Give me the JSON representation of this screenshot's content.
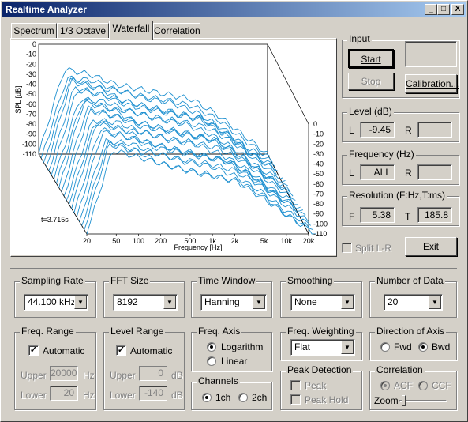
{
  "window": {
    "title": "Realtime Analyzer"
  },
  "title_buttons": {
    "minimize": "_",
    "maximize": "□",
    "close": "X"
  },
  "tabs": [
    "Spectrum",
    "1/3 Octave",
    "Waterfall",
    "Correlation"
  ],
  "selected_tab": "Waterfall",
  "plot": {
    "ylabel": "SPL [dB]",
    "xlabel": "Frequency [Hz]",
    "y_ticks": [
      "0",
      "-10",
      "-20",
      "-30",
      "-40",
      "-50",
      "-60",
      "-70",
      "-80",
      "-90",
      "-100",
      "-110"
    ],
    "z_ticks": [
      "0",
      "-10",
      "-20",
      "-30",
      "-40",
      "-50",
      "-60",
      "-70",
      "-80",
      "-90",
      "-100",
      "-110"
    ],
    "x_ticks": [
      "20",
      "50",
      "100",
      "200",
      "500",
      "1k",
      "2k",
      "5k",
      "10k",
      "20k"
    ],
    "time_label": "t=3.715s",
    "line_color": "#1e90d0"
  },
  "chart_data": {
    "type": "line",
    "title": "",
    "xlabel": "Frequency [Hz]",
    "ylabel": "SPL [dB]",
    "x": [
      20,
      50,
      100,
      200,
      500,
      1000,
      2000,
      5000,
      10000,
      20000
    ],
    "xscale": "log",
    "ylim": [
      -110,
      0
    ],
    "xlim": [
      20,
      20000
    ],
    "series": [
      {
        "values": [
          -110,
          -25,
          -30,
          -40,
          -45,
          -50,
          -55,
          -70,
          -90,
          -110
        ]
      },
      {
        "values": [
          -110,
          -30,
          -32,
          -42,
          -48,
          -52,
          -58,
          -72,
          -92,
          -110
        ]
      },
      {
        "values": [
          -110,
          -28,
          -35,
          -38,
          -46,
          -50,
          -60,
          -75,
          -95,
          -110
        ]
      },
      {
        "values": [
          -110,
          -22,
          -30,
          -44,
          -50,
          -55,
          -62,
          -78,
          -96,
          -110
        ]
      },
      {
        "values": [
          -110,
          -26,
          -33,
          -40,
          -47,
          -53,
          -57,
          -73,
          -94,
          -110
        ]
      }
    ]
  },
  "input": {
    "label": "Input",
    "start": "Start",
    "stop": "Stop",
    "calibration": "Calibration..."
  },
  "level": {
    "label": "Level (dB)",
    "l_label": "L",
    "l_value": "-9.45",
    "r_label": "R",
    "r_value": ""
  },
  "frequency": {
    "label": "Frequency (Hz)",
    "l_label": "L",
    "l_value": "ALL",
    "r_label": "R",
    "r_value": ""
  },
  "resolution": {
    "label": "Resolution (F:Hz,T:ms)",
    "f_label": "F",
    "f_value": "5.38",
    "t_label": "T",
    "t_value": "185.8"
  },
  "split": {
    "label": "Split L-R"
  },
  "exit": {
    "label": "Exit"
  },
  "sampling_rate": {
    "label": "Sampling Rate",
    "value": "44.100 kHz"
  },
  "fft_size": {
    "label": "FFT Size",
    "value": "8192"
  },
  "time_window": {
    "label": "Time Window",
    "value": "Hanning"
  },
  "smoothing": {
    "label": "Smoothing",
    "value": "None"
  },
  "num_data": {
    "label": "Number of Data",
    "value": "20"
  },
  "freq_range": {
    "label": "Freq. Range",
    "auto": "Automatic",
    "upper_label": "Upper",
    "upper_value": "20000",
    "upper_unit": "Hz",
    "lower_label": "Lower",
    "lower_value": "20",
    "lower_unit": "Hz"
  },
  "level_range": {
    "label": "Level Range",
    "auto": "Automatic",
    "upper_label": "Upper",
    "upper_value": "0",
    "upper_unit": "dB",
    "lower_label": "Lower",
    "lower_value": "-140",
    "lower_unit": "dB"
  },
  "freq_axis": {
    "label": "Freq. Axis",
    "log": "Logarithm",
    "lin": "Linear"
  },
  "channels": {
    "label": "Channels",
    "one": "1ch",
    "two": "2ch"
  },
  "freq_weighting": {
    "label": "Freq. Weighting",
    "value": "Flat"
  },
  "peak_detection": {
    "label": "Peak Detection",
    "peak": "Peak",
    "peak_hold": "Peak Hold"
  },
  "direction": {
    "label": "Direction of Axis",
    "fwd": "Fwd",
    "bwd": "Bwd"
  },
  "correlation": {
    "label": "Correlation",
    "acf": "ACF",
    "ccf": "CCF",
    "zoom": "Zoom"
  }
}
